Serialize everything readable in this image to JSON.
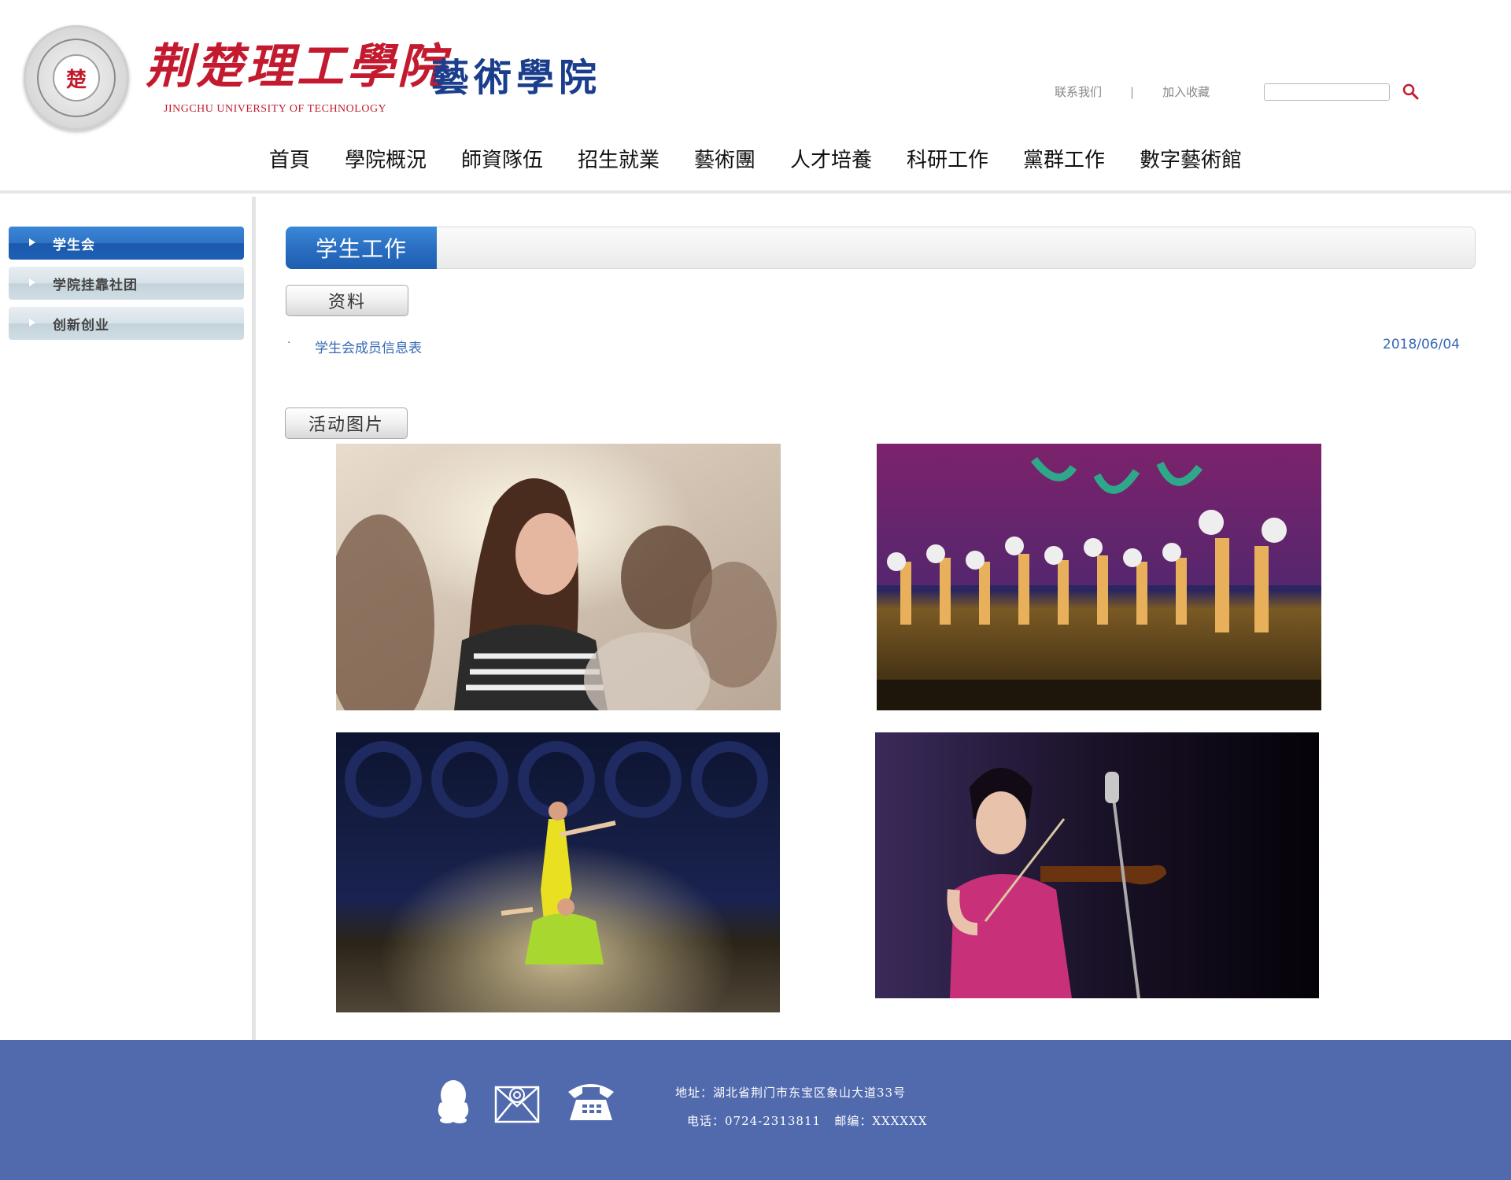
{
  "header": {
    "school_cn": "荆楚理工學院",
    "school_en": "JINGCHU UNIVERSITY OF TECHNOLOGY",
    "college": "藝術學院",
    "seal_char": "楚",
    "links": {
      "contact": "联系我们",
      "separator": "|",
      "favorite": "加入收藏"
    },
    "search": {
      "value": ""
    }
  },
  "nav": [
    "首頁",
    "學院概況",
    "師資隊伍",
    "招生就業",
    "藝術團",
    "人才培養",
    "科研工作",
    "黨群工作",
    "數字藝術館"
  ],
  "sidebar": {
    "items": [
      {
        "label": "学生会",
        "active": true
      },
      {
        "label": "学院挂靠社团",
        "active": false
      },
      {
        "label": "创新创业",
        "active": false
      }
    ]
  },
  "main": {
    "title": "学生工作",
    "section1": {
      "label": "资料",
      "items": [
        {
          "bullet": "·",
          "title": "学生会成员信息表",
          "date": "2018/06/04"
        }
      ]
    },
    "section2": {
      "label": "活动图片"
    }
  },
  "footer": {
    "address": "地址：湖北省荆门市东宝区象山大道33号",
    "phone_postcode": "电话：0724-2313811   邮编：XXXXXX"
  },
  "colors": {
    "brand_red": "#c41a2f",
    "brand_blue": "#1a3e8c",
    "accent_blue": "#2b6fc2",
    "link_blue": "#3668b5",
    "footer_bg": "#516aad"
  },
  "icons": [
    "search-icon",
    "qq-icon",
    "mail-icon",
    "telephone-icon",
    "triangle-right-icon"
  ]
}
